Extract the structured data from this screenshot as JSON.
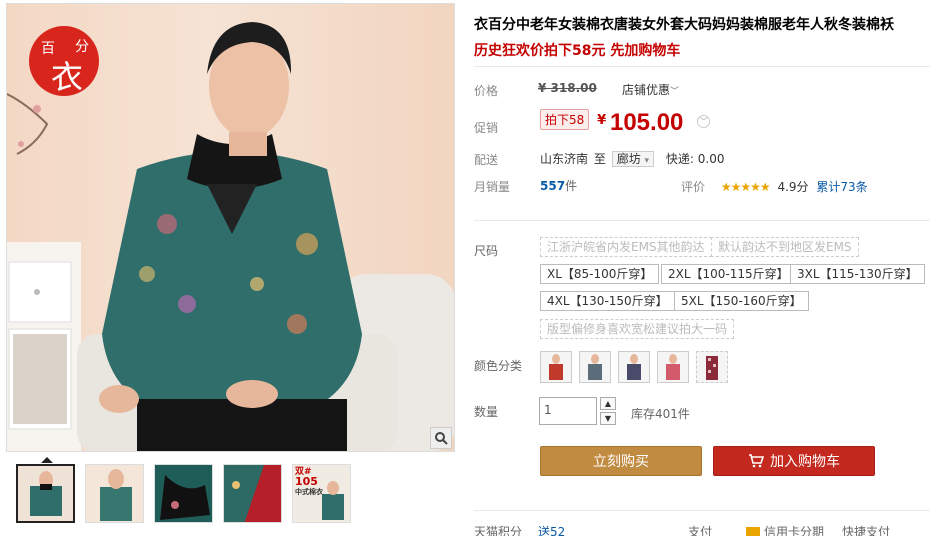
{
  "gallery": {
    "logo_chars": [
      "百",
      "分",
      "衣"
    ],
    "zoom_icon": "magnifier-icon",
    "thumbnail_count": 5,
    "thumb5_text": [
      "双#",
      "105",
      "中式棉衣"
    ]
  },
  "product": {
    "title": "衣百分中老年女装棉衣唐装女外套大码妈妈装棉服老年人秋冬装棉袄",
    "promo": "历史狂欢价拍下58元 先加购物车"
  },
  "price": {
    "label": "价格",
    "original": "¥ 318.00",
    "discount_link": "店铺优惠",
    "discount_chevron": "﹀"
  },
  "promo_price": {
    "label": "促销",
    "tag": "拍下58",
    "symbol": "¥",
    "value": "105.00",
    "chevron": "﹀"
  },
  "shipping": {
    "label": "配送",
    "from": "山东济南",
    "to_word": "至",
    "destination": "廊坊",
    "dropdown": "▾",
    "fee": "快递: 0.00"
  },
  "sales": {
    "label": "月销量",
    "count": "557",
    "unit": "件",
    "rating_label": "评价",
    "stars": "★★★★★",
    "score": "4.9分",
    "reviews": "累计73条"
  },
  "size": {
    "label": "尺码",
    "notes": [
      "江浙沪皖省内发EMS其他韵达",
      "默认韵达不到地区发EMS",
      "版型偏修身喜欢宽松建议拍大一码"
    ],
    "options": [
      "XL【85-100斤穿】",
      "2XL【100-115斤穿】",
      "3XL【115-130斤穿】",
      "4XL【130-150斤穿】",
      "5XL【150-160斤穿】"
    ]
  },
  "color": {
    "label": "颜色分类",
    "swatch_colors": [
      "#c0392b",
      "#5b6d7a",
      "#4a4a6a",
      "#d35a6a",
      "#8a2a3a"
    ]
  },
  "quantity": {
    "label": "数量",
    "value": "1",
    "up": "▲",
    "down": "▼",
    "stock": "库存401件"
  },
  "actions": {
    "buy_now": "立刻购买",
    "cart_icon": "shopping-cart-icon",
    "add_to_cart": "加入购物车"
  },
  "footer": {
    "points_label": "天猫积分",
    "points_value": "送52",
    "pay_label": "支付",
    "credit_card": "信用卡分期",
    "quick_pay": "快捷支付"
  },
  "colors": {
    "accent_red": "#c40000",
    "buy_button": "#c28b42",
    "cart_button": "#c4291f",
    "link": "#0b5aa8"
  }
}
